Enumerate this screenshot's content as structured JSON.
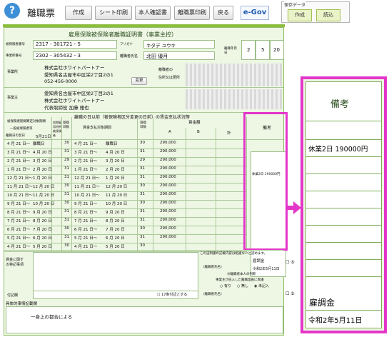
{
  "toolbar": {
    "title": "離職票",
    "buttons": [
      "作成",
      "シート印刷",
      "本人確認書",
      "離職票印刷",
      "戻る"
    ],
    "egov": "e-Gov",
    "save_group_label": "保存データ",
    "save_button": "作成",
    "load_button": "読込"
  },
  "form": {
    "title": "雇用保険被保険者離職証明書（事業主控）",
    "insured_number_label": "被保険者番号",
    "insured_number": "2317 - 301721 - 5",
    "office_number_label": "事業所番号",
    "office_number": "2302 - 305432 - 3",
    "furigana_label": "フリガナ",
    "furigana": "キタデ ユウキ",
    "name_label": "離職者氏名",
    "name": "北田 優月",
    "separation_date_label": "離職年月日",
    "sep_year": "2",
    "sep_month": "5",
    "sep_day": "20",
    "employer_label": "事業所",
    "company_name": "株式会社ホワイトパートナー",
    "company_address": "愛知県名古屋市中区栄2丁目2の1",
    "company_phone": "052-456-0000",
    "change_button": "変更",
    "employer_info_label": "事業主",
    "employer_address": "愛知県名古屋市中区栄2丁目2の1",
    "employer_company": "株式会社ホワイトパートナー",
    "employer_rep": "代表取締役 加藤 雅也",
    "separated_person_label": "離職者の",
    "separated_person_sub": "住所又は居所",
    "wage_section_title": "離職の日以前（被保険者区分変更の日前）の賃金支払状況等",
    "col_period": "被保険者期間算定対象期間",
    "col_general": "一般被保険者等",
    "col_short": "短期雇用特例被保険者",
    "col_days": "基礎日数",
    "col_wage_period": "賃金支払対象期間",
    "col_base_days": "基礎日数",
    "col_wage": "賃金額",
    "col_a": "A",
    "col_b": "B",
    "col_total": "計",
    "col_remarks": "備考",
    "day_after_sep_label": "離職日の翌日",
    "day_after_sep": "5月21日",
    "rows": [
      {
        "from": "4 月 21 日～",
        "to": "離職日",
        "days": "30",
        "wfrom": "4 月 21 日～",
        "wto": "離職日",
        "wdays": "30",
        "wage": "290,000",
        "remark": ""
      },
      {
        "from": "3 月 21 日～",
        "to": "4 月 20 日",
        "days": "31",
        "wfrom": "3 月 21 日～",
        "wto": "4 月 20 日",
        "wdays": "31",
        "wage": "290,000",
        "remark": "休業2日 190000円"
      },
      {
        "from": "2 月 21 日～",
        "to": "3 月 20 日",
        "days": "29",
        "wfrom": "2 月 21 日～",
        "wto": "3 月 20 日",
        "wdays": "29",
        "wage": "290,000",
        "remark": ""
      },
      {
        "from": "1 月 21 日～",
        "to": "2 月 20 日",
        "days": "31",
        "wfrom": "1 月 21 日～",
        "wto": "2 月 20 日",
        "wdays": "31",
        "wage": "290,000",
        "remark": ""
      },
      {
        "from": "12 月 21 日～",
        "to": "1 月 20 日",
        "days": "31",
        "wfrom": "12 月 21 日～",
        "wto": "1 月 20 日",
        "wdays": "31",
        "wage": "290,000",
        "remark": ""
      },
      {
        "from": "11 月 21 日～",
        "to": "12 月 20 日",
        "days": "30",
        "wfrom": "11 月 21 日～",
        "wto": "12 月 20 日",
        "wdays": "30",
        "wage": "290,000",
        "remark": ""
      },
      {
        "from": "10 月 21 日～",
        "to": "11 月 20 日",
        "days": "31",
        "wfrom": "10 月 21 日～",
        "wto": "11 月 20 日",
        "wdays": "31",
        "wage": "290,000",
        "remark": ""
      },
      {
        "from": "9 月 21 日～",
        "to": "10 月 20 日",
        "days": "30",
        "wfrom": "9 月 21 日～",
        "wto": "10 月 20 日",
        "wdays": "30",
        "wage": "290,000",
        "remark": ""
      },
      {
        "from": "8 月 21 日～",
        "to": "9 月 20 日",
        "days": "31",
        "wfrom": "8 月 21 日～",
        "wto": "9 月 20 日",
        "wdays": "31",
        "wage": "290,000",
        "remark": ""
      },
      {
        "from": "7 月 21 日～",
        "to": "8 月 20 日",
        "days": "31",
        "wfrom": "7 月 21 日～",
        "wto": "8 月 20 日",
        "wdays": "31",
        "wage": "290,000",
        "remark": ""
      },
      {
        "from": "6 月 21 日～",
        "to": "7 月 20 日",
        "days": "30",
        "wfrom": "6 月 21 日～",
        "wto": "7 月 20 日",
        "wdays": "30",
        "wage": "290,000",
        "remark": ""
      },
      {
        "from": "5 月 21 日～",
        "to": "6 月 20 日",
        "days": "31",
        "wfrom": "5 月 21 日～",
        "wto": "6 月 20 日",
        "wdays": "31",
        "wage": "290,000",
        "remark": ""
      },
      {
        "from": "4 月 21 日～",
        "to": "5 月 20 日",
        "days": "30",
        "wfrom": "4 月 21 日～",
        "wto": "5 月 20 日",
        "wdays": "30",
        "wage": "",
        "remark": ""
      }
    ],
    "remark_bottom_1": "雇調金",
    "remark_bottom_2": "令和2年5月11日",
    "wage_special_label": "賃金に関する特記事項",
    "cert_label": "この証明書の記載内容は相違ないと認めます。",
    "separated_name_label": "（離職者氏名）",
    "judgment_label": "⑯離職者本人の判断",
    "judgment_sub": "事業主が記入した離職理由に異議",
    "radio_yes": "有り",
    "radio_no": "無し",
    "radio_unfilled": "未記入",
    "supplement_label": "付記欄",
    "note_17": "17条付記とする",
    "specific_label": "具体的事情記載欄",
    "specific_text": "一身上の都合による"
  },
  "zoom": {
    "header": "備考",
    "remark_1": "休業2日 190000円",
    "remark_2": "雇調金",
    "remark_3": "令和2年5月11日"
  }
}
